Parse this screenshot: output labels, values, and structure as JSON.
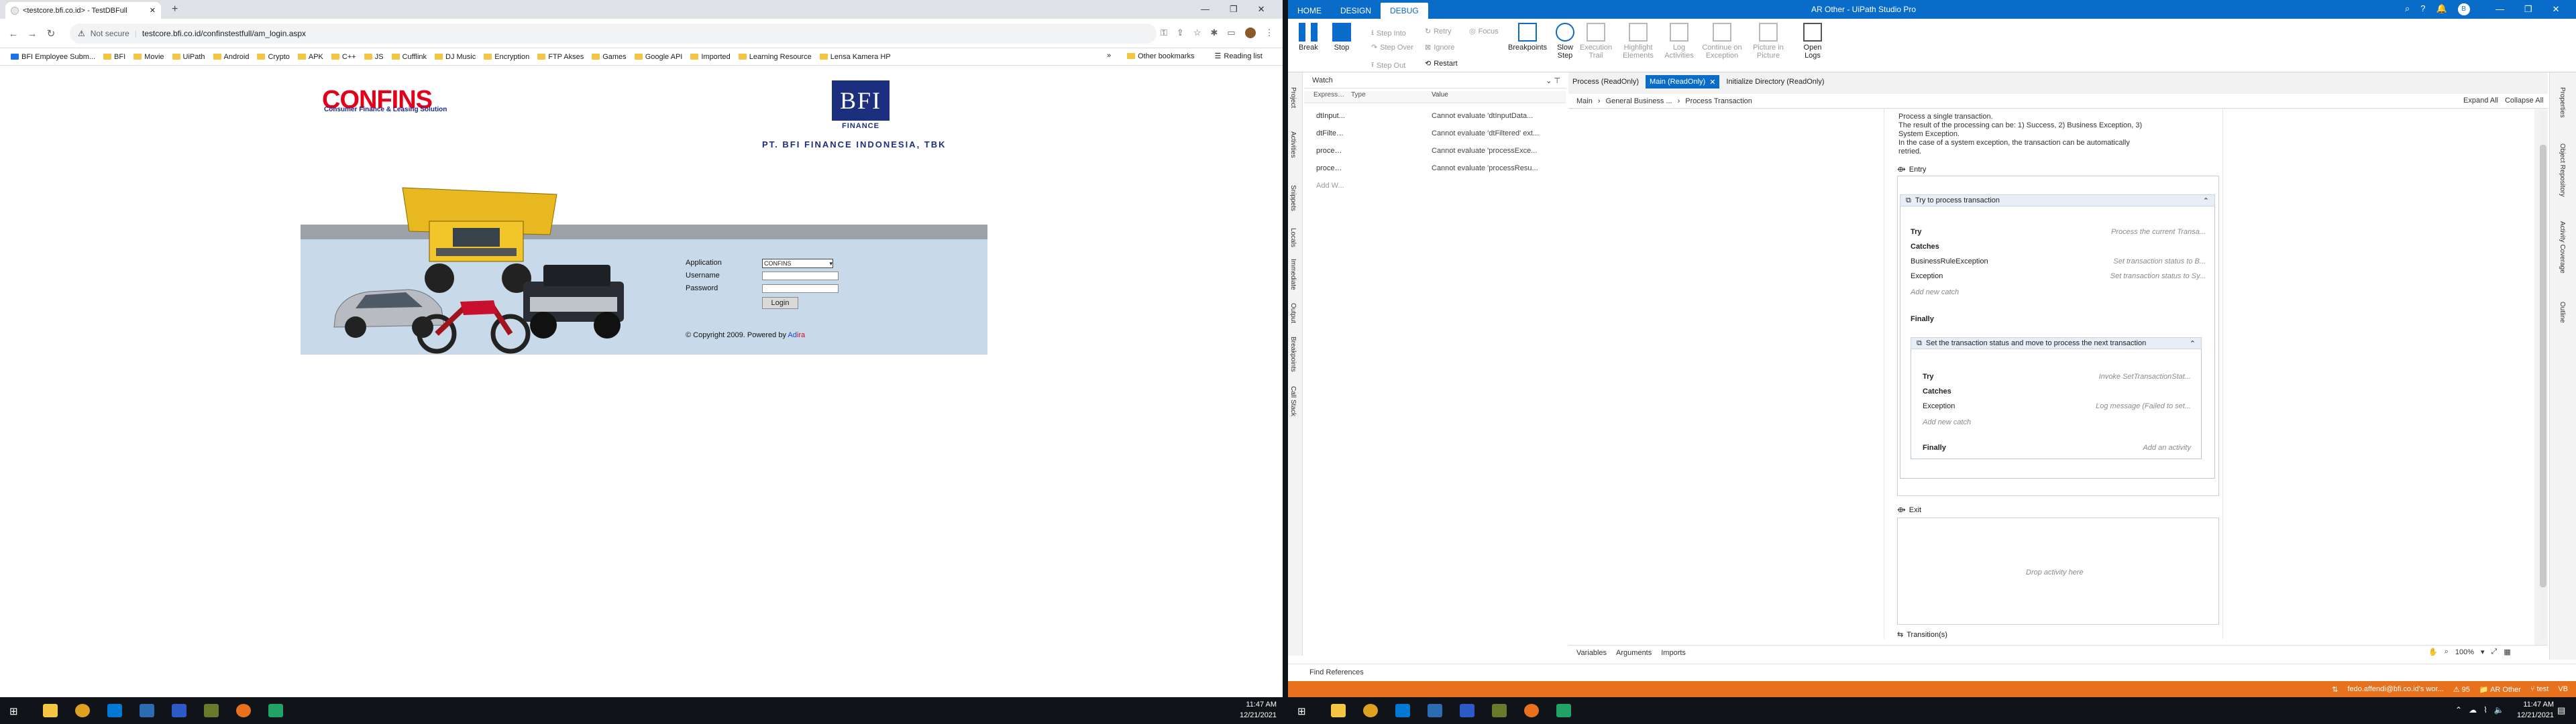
{
  "browser": {
    "tab_title": "<testcore.bfi.co.id> - TestDBFull",
    "address": {
      "security_label": "Not secure",
      "url": "testcore.bfi.co.id/confinstestfull/am_login.aspx"
    },
    "bookmarks": [
      "BFI Employee Subm...",
      "BFI",
      "Movie",
      "UiPath",
      "Android",
      "Crypto",
      "APK",
      "C++",
      "JS",
      "Cufflink",
      "DJ Music",
      "Encryption",
      "FTP Akses",
      "Games",
      "Google API",
      "Imported",
      "Learning Resource",
      "Lensa Kamera HP"
    ],
    "other_bookmarks": "Other bookmarks",
    "reading_list": "Reading list"
  },
  "login_page": {
    "confins_logo": "CONFINS",
    "confins_tagline": "Consumer Finance & Leasing Solution",
    "bfi_logo": "BFI",
    "bfi_finance": "FINANCE",
    "company_name": "PT. BFI FINANCE INDONESIA, TBK",
    "labels": {
      "application": "Application",
      "username": "Username",
      "password": "Password"
    },
    "application_value": "CONFINS",
    "login_button": "Login",
    "copyright_prefix": "© Copyright 2009. Powered by",
    "powered_ad": "Ad",
    "powered_ira": "ira"
  },
  "taskbar_left": {
    "time": "11:47 AM",
    "date": "12/21/2021"
  },
  "studio": {
    "window_title": "AR Other - UiPath Studio Pro",
    "ribbon_tabs": [
      "HOME",
      "DESIGN",
      "DEBUG"
    ],
    "ribbon": {
      "break": "Break",
      "stop": "Stop",
      "step_into": "Step Into",
      "step_over": "Step Over",
      "step_out": "Step Out",
      "retry": "Retry",
      "ignore": "Ignore",
      "restart": "Restart",
      "focus": "Focus",
      "breakpoints": "Breakpoints",
      "slow_step": "Slow Step",
      "execution_trail": "Execution Trail",
      "highlight_elements": "Highlight Elements",
      "log_activities": "Log Activities",
      "continue_on_exception": "Continue on Exception",
      "picture_in_picture": "Picture in Picture",
      "open_logs": "Open Logs"
    },
    "rail_left": [
      "Project",
      "Activities",
      "Snippets",
      "Locals",
      "Immediate",
      "Output",
      "Breakpoints",
      "Call Stack"
    ],
    "watch": {
      "title": "Watch",
      "columns": [
        "Expression",
        "Type",
        "Value"
      ],
      "rows": [
        {
          "expr": "dtInput...",
          "type": "",
          "value": "Cannot evaluate 'dtInputData..."
        },
        {
          "expr": "dtFiltered",
          "type": "",
          "value": "Cannot evaluate 'dtFiltered' ext..."
        },
        {
          "expr": "process...",
          "type": "",
          "value": "Cannot evaluate 'processExce..."
        },
        {
          "expr": "process...",
          "type": "",
          "value": "Cannot evaluate 'processResu..."
        }
      ],
      "add_watch": "Add W..."
    },
    "doc_tabs": [
      "Process (ReadOnly)",
      "Main (ReadOnly)",
      "Initialize Directory (ReadOnly)"
    ],
    "breadcrumb": [
      "Main",
      "General Business ...",
      "Process Transaction"
    ],
    "expand_all": "Expand All",
    "collapse_all": "Collapse All",
    "description": [
      "Process a single transaction.",
      "The result of the processing can be: 1) Success, 2) Business Exception, 3) System Exception.",
      "In the case of a system exception, the transaction can be automatically retried."
    ],
    "entry": "Entry",
    "try_outer": {
      "title": "Try to process transaction",
      "try": "Try",
      "try_value": "Process the current Transa...",
      "catches": "Catches",
      "catch1": "BusinessRuleException",
      "catch1_value": "Set transaction status to B...",
      "catch2": "Exception",
      "catch2_value": "Set transaction status to Sy...",
      "add_catch": "Add new catch",
      "finally": "Finally"
    },
    "try_inner": {
      "title": "Set the transaction status and move to process the next transaction",
      "try": "Try",
      "try_value": "Invoke SetTransactionStat...",
      "catches": "Catches",
      "catch1": "Exception",
      "catch1_value": "Log message (Failed to set...",
      "add_catch": "Add new catch",
      "finally": "Finally",
      "finally_value": "Add an activity"
    },
    "exit": "Exit",
    "drop_activity": "Drop activity here",
    "transitions": "Transition(s)",
    "bottom_tabs": [
      "Variables",
      "Arguments",
      "Imports"
    ],
    "zoom": "100%",
    "find_references": "Find References",
    "rail_right": [
      "Properties",
      "Object Repository",
      "Activity Coverage",
      "Outline"
    ],
    "status": {
      "user": "fedo.affendi@bfi.co.id's wor...",
      "errors": "95",
      "project": "AR Other",
      "branch": "test",
      "lang": "VB"
    }
  },
  "taskbar_right": {
    "time": "11:47 AM",
    "date": "12/21/2021"
  },
  "colors": {
    "uipath_blue": "#0a6cc9",
    "status_orange": "#e8711d",
    "confins_red": "#e2001a",
    "bfi_navy": "#1c2f7e"
  }
}
